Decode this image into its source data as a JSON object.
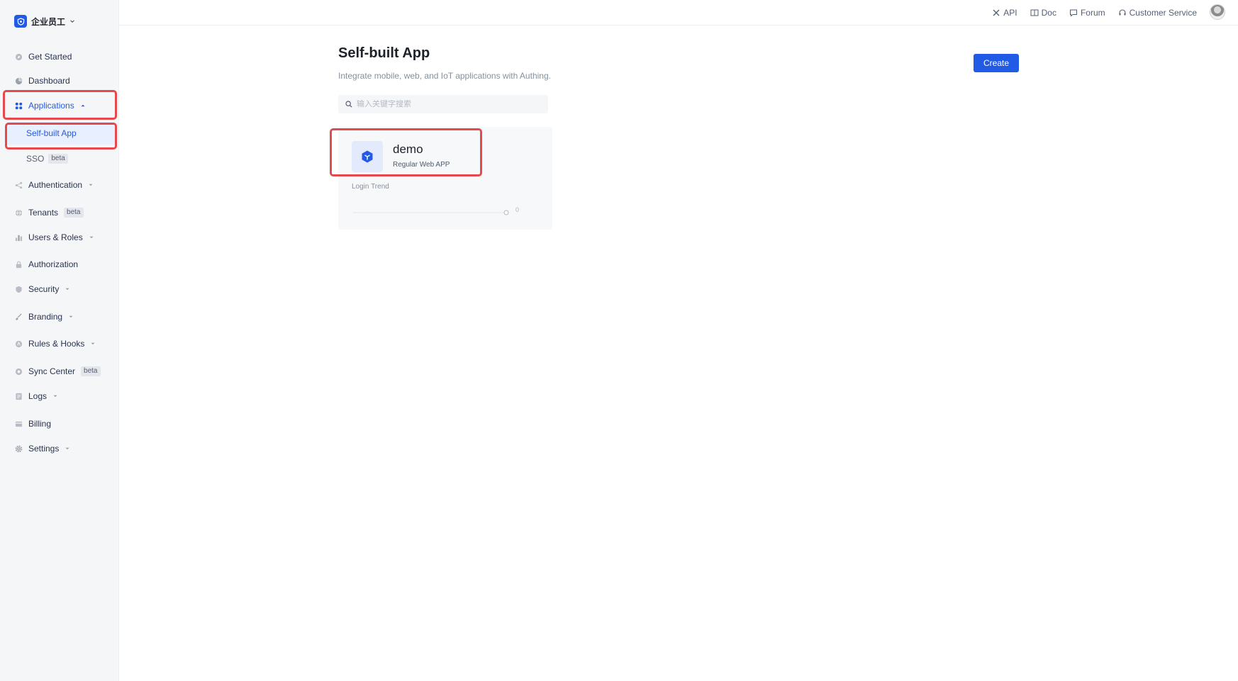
{
  "brand": {
    "name": "企业员工"
  },
  "sidebar": {
    "items": [
      {
        "label": "Get Started"
      },
      {
        "label": "Dashboard"
      },
      {
        "label": "Applications"
      },
      {
        "label": "Authentication"
      },
      {
        "label": "Tenants",
        "badge": "beta"
      },
      {
        "label": "Users & Roles"
      },
      {
        "label": "Authorization"
      },
      {
        "label": "Security"
      },
      {
        "label": "Branding"
      },
      {
        "label": "Rules & Hooks"
      },
      {
        "label": "Sync Center",
        "badge": "beta"
      },
      {
        "label": "Logs"
      },
      {
        "label": "Billing"
      },
      {
        "label": "Settings"
      }
    ],
    "sub_items": [
      {
        "label": "Self-built App"
      },
      {
        "label": "SSO",
        "badge": "beta"
      }
    ]
  },
  "topbar": {
    "links": [
      {
        "label": "API"
      },
      {
        "label": "Doc"
      },
      {
        "label": "Forum"
      },
      {
        "label": "Customer Service"
      }
    ]
  },
  "main": {
    "title": "Self-built App",
    "subtitle": "Integrate mobile, web, and IoT applications with Authing.",
    "create_label": "Create",
    "search_placeholder": "输入关键字搜索",
    "apps": [
      {
        "name": "demo",
        "type": "Regular Web APP",
        "trend_label": "Login Trend",
        "trend_value": "0"
      }
    ]
  },
  "colors": {
    "accent": "#215ae5",
    "highlight": "#e5484d"
  }
}
